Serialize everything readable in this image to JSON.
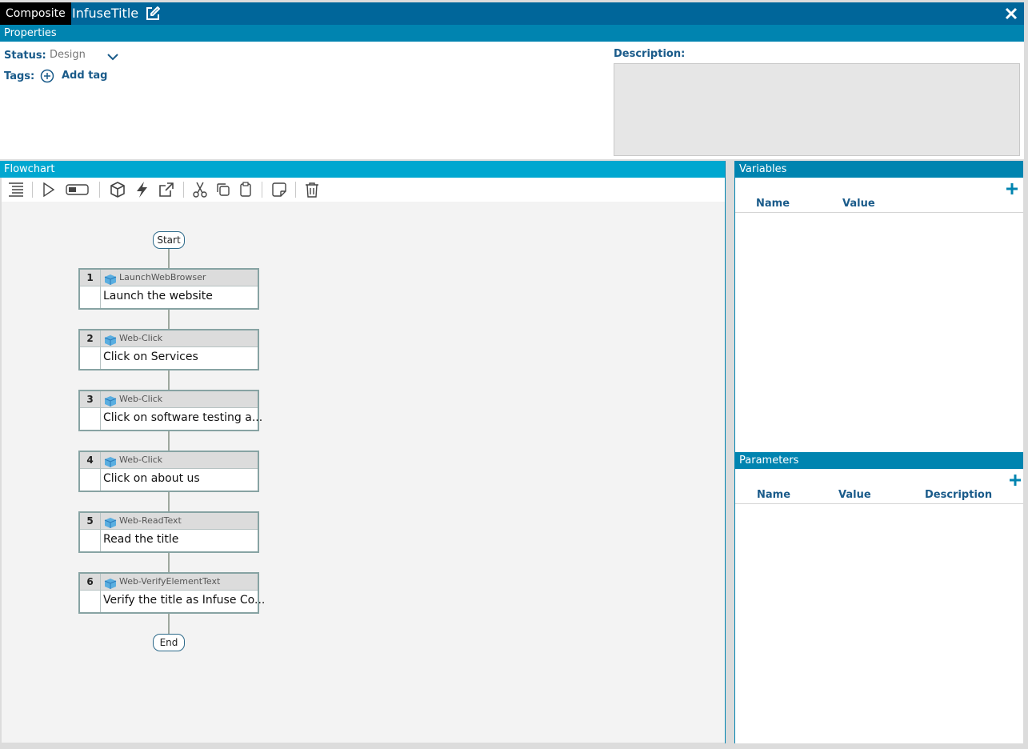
{
  "window": {
    "type_label": "Composite",
    "title": "InfuseTitle"
  },
  "properties": {
    "header": "Properties",
    "status_label": "Status:",
    "status_value": "Design",
    "tags_label": "Tags:",
    "add_tag": "Add tag",
    "description_label": "Description:",
    "description_value": ""
  },
  "flowchart": {
    "header": "Flowchart",
    "start": "Start",
    "end": "End",
    "steps": [
      {
        "num": "1",
        "action": "LaunchWebBrowser",
        "desc": "Launch the website"
      },
      {
        "num": "2",
        "action": "Web-Click",
        "desc": "Click on Services"
      },
      {
        "num": "3",
        "action": "Web-Click",
        "desc": "Click on software testing a..."
      },
      {
        "num": "4",
        "action": "Web-Click",
        "desc": "Click on about us"
      },
      {
        "num": "5",
        "action": "Web-ReadText",
        "desc": "Read the title"
      },
      {
        "num": "6",
        "action": "Web-VerifyElementText",
        "desc": "Verify the title as Infuse Co..."
      }
    ],
    "toolbar_icons": [
      "align-icon",
      "play-icon",
      "toggle-icon",
      "package-icon",
      "lightning-icon",
      "external-link-icon",
      "cut-icon",
      "copy-icon",
      "paste-icon",
      "note-icon",
      "delete-icon"
    ]
  },
  "variables": {
    "header": "Variables",
    "col_name": "Name",
    "col_value": "Value"
  },
  "parameters": {
    "header": "Parameters",
    "col_name": "Name",
    "col_value": "Value",
    "col_description": "Description"
  },
  "colors": {
    "titlebar": "#00669a",
    "section_header": "#0084b0",
    "flowchart_header": "#00a7d0",
    "label_blue": "#1a5b8a"
  }
}
